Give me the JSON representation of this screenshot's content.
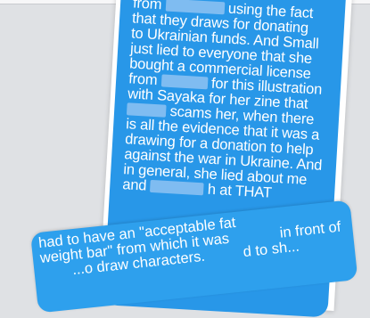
{
  "message_main": {
    "lines": [
      "from",
      "using the fact",
      "that they draws for donating",
      "to Ukrainian funds. And Small",
      "just lied to everyone that she",
      "bought a commercial license",
      "from",
      "for this illustration",
      "with Sayaka for her zine that",
      "scams her, when there",
      "is all the evidence that it was a",
      "drawing for a donation to help",
      "against the war in Ukraine. And",
      "in general, she lied about me",
      "and",
      "h at THAT"
    ]
  },
  "message_overlap": {
    "lines": [
      "had to have an \"acceptable fat",
      "weight bar\" from which it was",
      "in front of",
      "...o draw characters.",
      "d to sh..."
    ]
  },
  "colors": {
    "bubble": "#2897e8",
    "bubble_secondary": "#2ea0ed",
    "redaction": "#7fbcf1"
  }
}
